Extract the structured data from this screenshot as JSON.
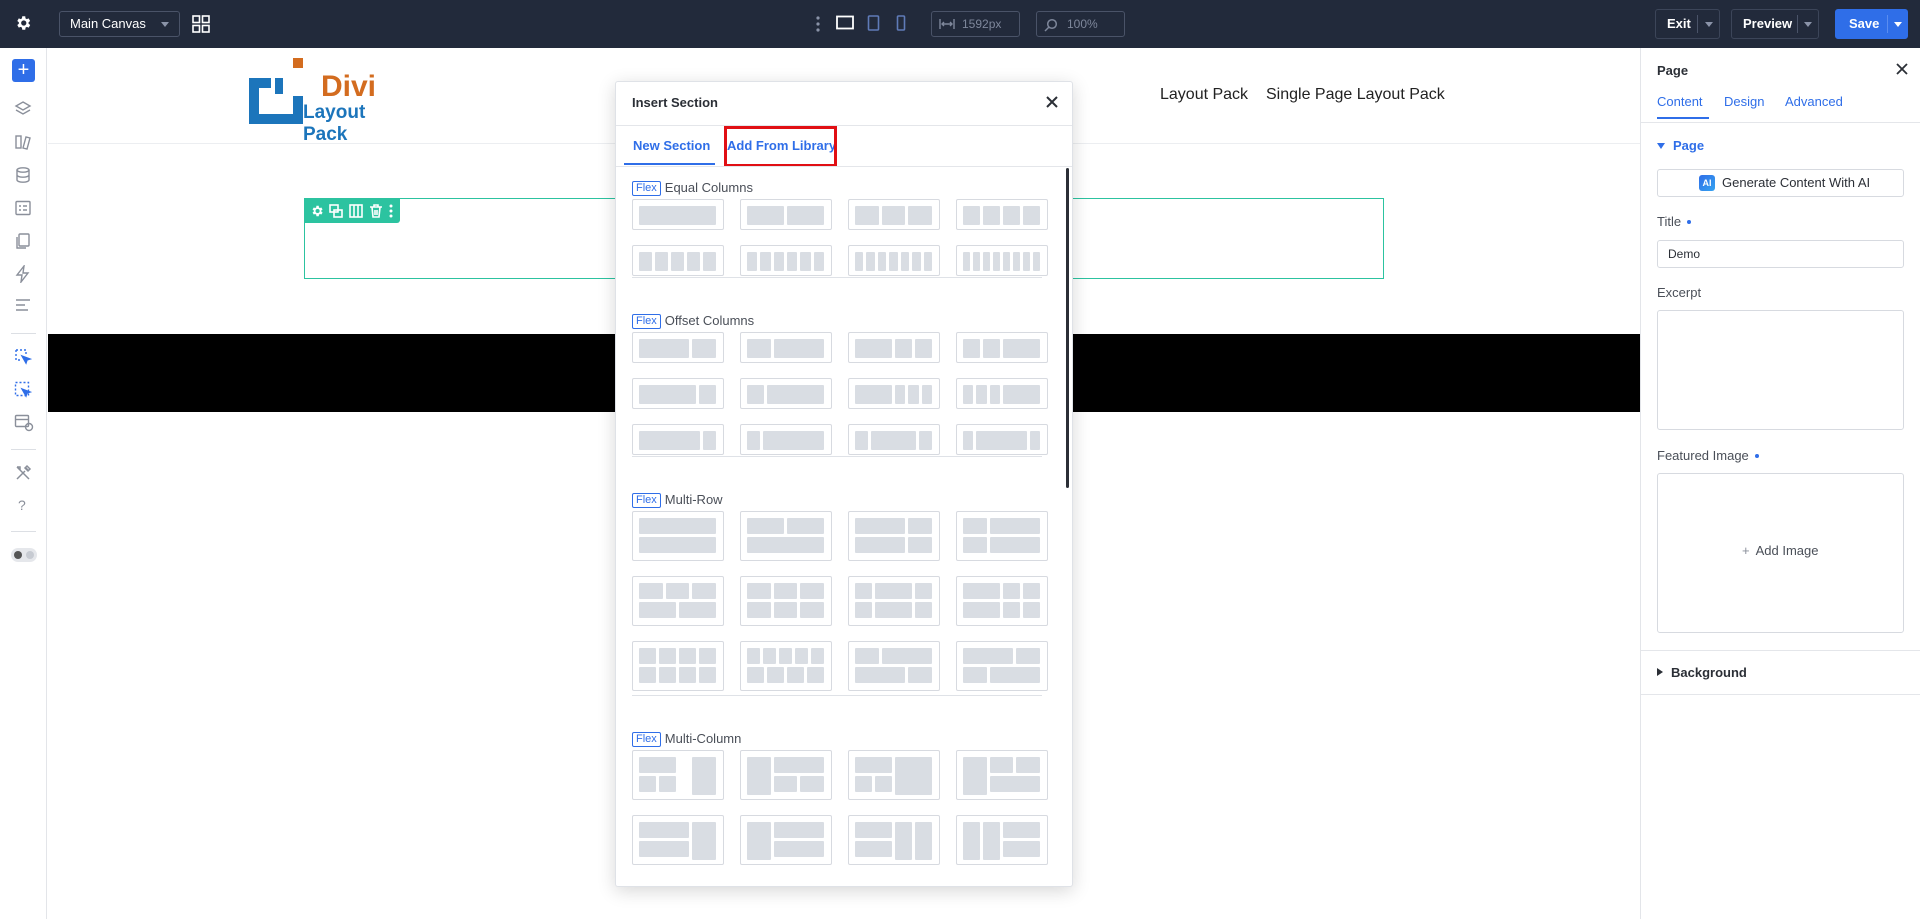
{
  "topbar": {
    "settings_icon": "gear-icon",
    "canvas_select": "Main Canvas",
    "canvas_grid_icon": "grid-icon",
    "more_icon": "vertical-dots-icon",
    "devices": [
      "desktop-icon",
      "tablet-icon",
      "phone-icon"
    ],
    "width_value": "1592px",
    "zoom_value": "100%",
    "exit_label": "Exit",
    "preview_label": "Preview",
    "save_label": "Save",
    "colors": {
      "bar": "#222a3b",
      "save_button": "#2f6ee8"
    }
  },
  "leftbar": {
    "add_label": "+",
    "icons": [
      "layers-icon",
      "modules-icon",
      "database-icon",
      "form-icon",
      "pages-icon",
      "lightning-icon",
      "list-icon",
      "select-icon",
      "select-all-icon",
      "template-icon",
      "tools-icon",
      "help-icon",
      "theme-toggle-icon"
    ],
    "help_label": "?"
  },
  "site": {
    "logo_line1": "Divi",
    "logo_line2": "Layout Pack",
    "nav": [
      "Layout Pack",
      "Single Page Layout Pack"
    ]
  },
  "row_toolbar": {
    "icons": [
      "row-settings-icon",
      "row-duplicate-icon",
      "row-columns-icon",
      "row-delete-icon",
      "row-more-icon"
    ]
  },
  "modal": {
    "title": "Insert Section",
    "close_icon": "close-icon",
    "tabs": [
      {
        "label": "New Section",
        "active": true
      },
      {
        "label": "Add From Library",
        "active": false
      }
    ],
    "flex_badge": "Flex",
    "categories": [
      {
        "name": "Equal Columns",
        "layouts": 8
      },
      {
        "name": "Offset Columns",
        "layouts": 12
      },
      {
        "name": "Multi-Row",
        "layouts": 12
      },
      {
        "name": "Multi-Column",
        "layouts": 8
      }
    ],
    "highlight_color": "#e10f14"
  },
  "right_panel": {
    "title": "Page",
    "close_icon": "close-icon",
    "tabs": [
      "Content",
      "Design",
      "Advanced"
    ],
    "active_tab": "Content",
    "section_page": "Page",
    "ai_badge": "AI",
    "ai_button": "Generate Content With AI",
    "title_label": "Title",
    "title_value": "Demo",
    "excerpt_label": "Excerpt",
    "excerpt_value": "",
    "featured_label": "Featured Image",
    "add_image": "Add Image",
    "background_label": "Background",
    "accent_color": "#2f6ee8"
  }
}
